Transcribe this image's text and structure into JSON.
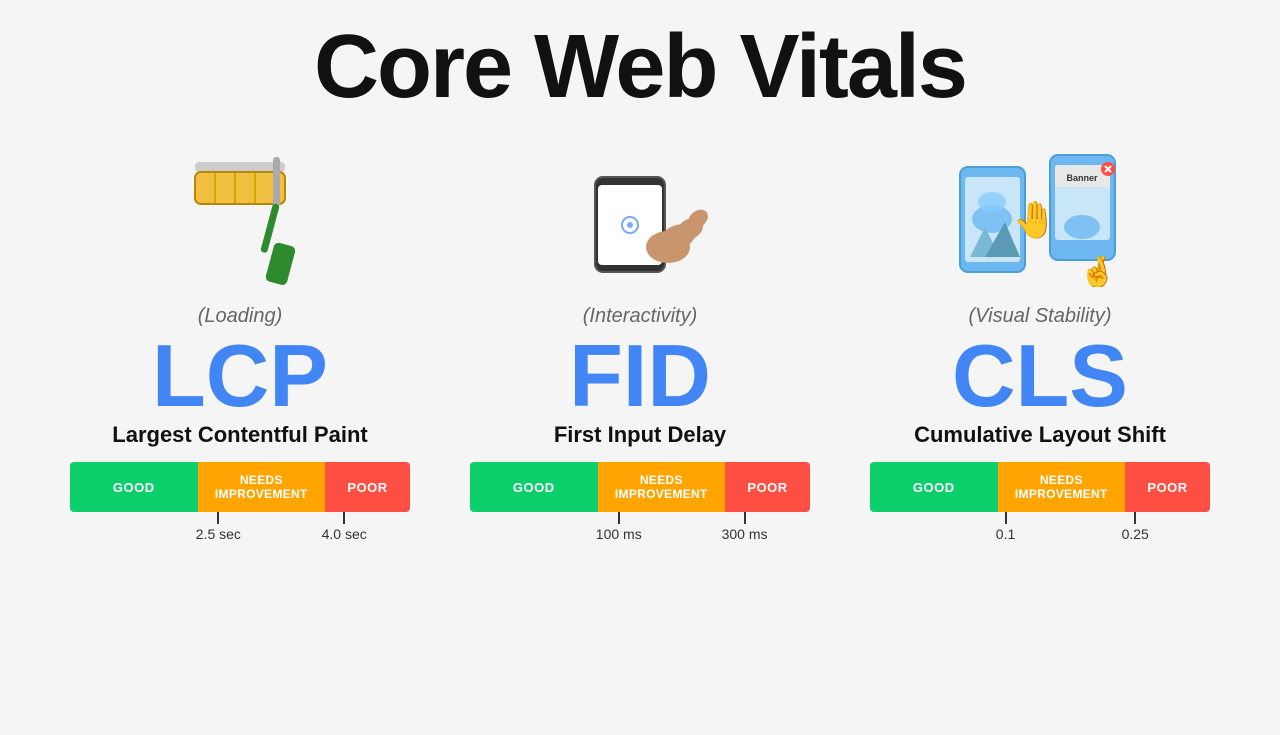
{
  "title": "Core Web Vitals",
  "vitals": [
    {
      "id": "lcp",
      "acronym": "LCP",
      "name": "Largest Contentful Paint",
      "category": "(Loading)",
      "bars": [
        {
          "label": "GOOD",
          "flex": 3
        },
        {
          "label": "NEEDS\nIMPROVEMENT",
          "flex": 3
        },
        {
          "label": "POOR",
          "flex": 2
        }
      ],
      "markers": [
        {
          "label": "2.5 sec",
          "position": 37
        },
        {
          "label": "4.0 sec",
          "position": 74
        }
      ]
    },
    {
      "id": "fid",
      "acronym": "FID",
      "name": "First Input Delay",
      "category": "(Interactivity)",
      "bars": [
        {
          "label": "GOOD",
          "flex": 3
        },
        {
          "label": "NEEDS\nIMPROVEMENT",
          "flex": 3
        },
        {
          "label": "POOR",
          "flex": 2
        }
      ],
      "markers": [
        {
          "label": "100 ms",
          "position": 37
        },
        {
          "label": "300 ms",
          "position": 74
        }
      ]
    },
    {
      "id": "cls",
      "acronym": "CLS",
      "name": "Cumulative Layout Shift",
      "category": "(Visual Stability)",
      "bars": [
        {
          "label": "GOOD",
          "flex": 3
        },
        {
          "label": "NEEDS\nIMPROVEMENT",
          "flex": 3
        },
        {
          "label": "POOR",
          "flex": 2
        }
      ],
      "markers": [
        {
          "label": "0.1",
          "position": 37
        },
        {
          "label": "0.25",
          "position": 74
        }
      ]
    }
  ],
  "colors": {
    "good": "#0cce6b",
    "needs": "#ffa400",
    "poor": "#ff4e42",
    "accent": "#4285f4"
  }
}
